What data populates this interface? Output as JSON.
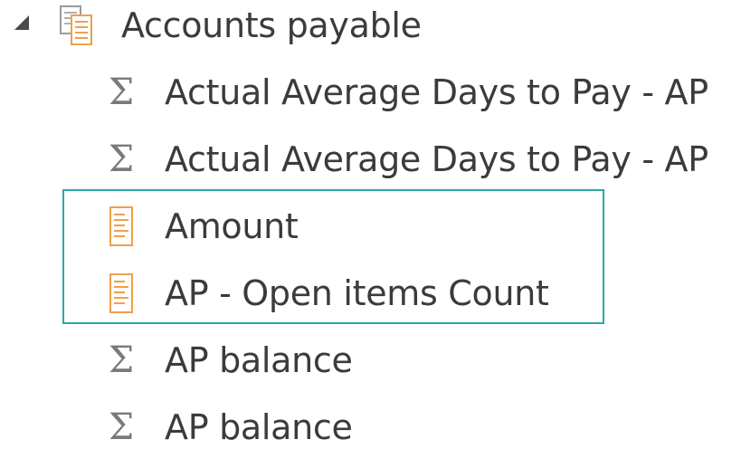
{
  "tree": {
    "table": {
      "label": "Accounts payable",
      "icon": "table-icon",
      "expander_icon": "collapse-triangle-icon"
    },
    "fields": [
      {
        "label": "Actual Average Days to Pay - AP",
        "icon": "sigma-icon"
      },
      {
        "label": "Actual Average Days to Pay - AP",
        "icon": "sigma-icon"
      },
      {
        "label": "Amount",
        "icon": "calculator-icon"
      },
      {
        "label": "AP - Open items Count",
        "icon": "calculator-icon"
      },
      {
        "label": "AP balance",
        "icon": "sigma-icon"
      },
      {
        "label": "AP balance",
        "icon": "sigma-icon"
      }
    ],
    "sigma_glyph": "Σ",
    "highlight_color": "#2aa9a3",
    "measure_icon_color": "#f0a04b"
  }
}
